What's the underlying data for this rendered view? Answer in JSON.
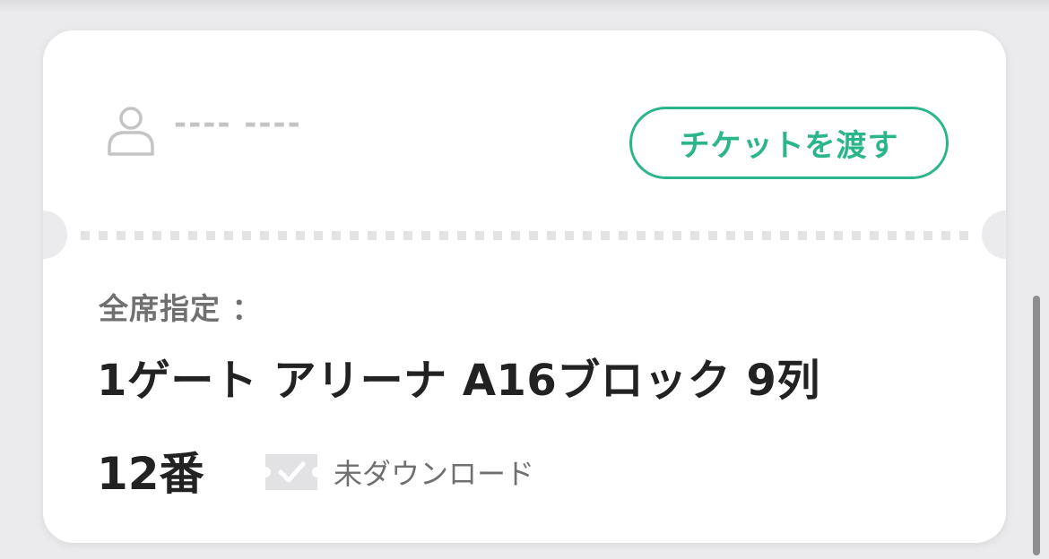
{
  "owner": {
    "name": "---- ----"
  },
  "transfer_button": {
    "label": "チケットを渡す"
  },
  "seat": {
    "label": "全席指定 ：",
    "line1": "1ゲート アリーナ A16ブロック 9列",
    "line2": "12番"
  },
  "download_status": {
    "label": "未ダウンロード"
  },
  "icons": {
    "owner": "person-icon",
    "download": "check-ticket-icon"
  },
  "colors": {
    "accent": "#2bb58a",
    "background": "#ebebed",
    "card": "#ffffff"
  }
}
